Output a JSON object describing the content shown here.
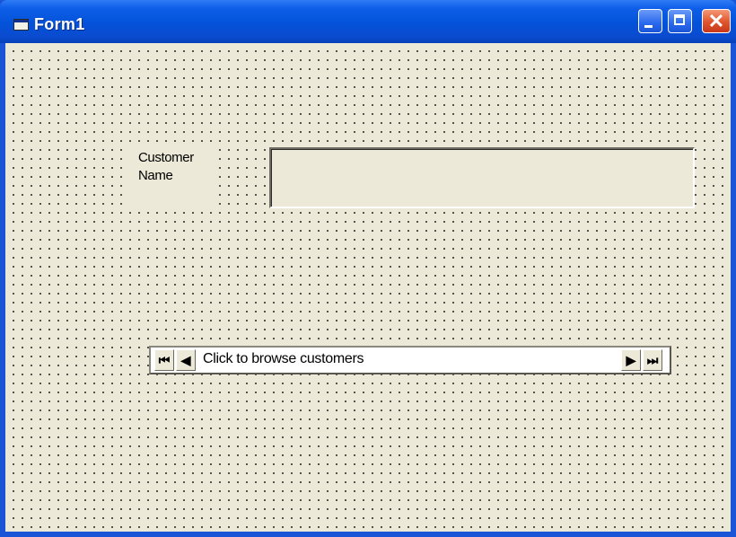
{
  "window": {
    "title": "Form1",
    "icon": "form-app-icon",
    "buttons": {
      "minimize_icon": "minimize-icon",
      "maximize_icon": "maximize-icon",
      "close_icon": "close-icon",
      "close_glyph": "✕"
    }
  },
  "form": {
    "customer_label": "Customer Name",
    "customer_name_value": "",
    "data_control": {
      "caption": "Click to browse customers",
      "first_glyph": "⏮",
      "prev_glyph": "◀",
      "next_glyph": "▶",
      "last_glyph": "⏭"
    }
  },
  "colors": {
    "titlebar": "#0452d8",
    "form_background": "#ece9d8",
    "close_button": "#e0542e"
  }
}
